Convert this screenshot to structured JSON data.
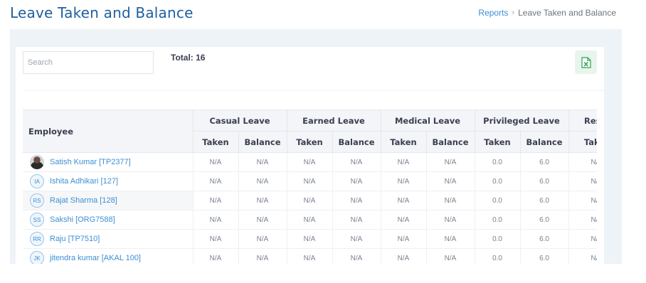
{
  "header": {
    "title": "Leave Taken and Balance",
    "breadcrumb": {
      "link": "Reports",
      "current": "Leave Taken and Balance"
    }
  },
  "toolbar": {
    "search_placeholder": "Search",
    "total": "Total: 16",
    "export_icon": "excel-icon"
  },
  "table": {
    "employee_header": "Employee",
    "leave_types": [
      "Casual Leave",
      "Earned Leave",
      "Medical Leave",
      "Privileged Leave",
      "Rest"
    ],
    "sub_headers": {
      "taken": "Taken",
      "balance": "Balance",
      "partial": "Take"
    },
    "rows": [
      {
        "name": "Satish Kumar [TP2377]",
        "initials": "",
        "photo": true,
        "values": [
          "N/A",
          "N/A",
          "N/A",
          "N/A",
          "N/A",
          "N/A",
          "0.0",
          "6.0",
          "N/"
        ]
      },
      {
        "name": "Ishita Adhikari [127]",
        "initials": "IA",
        "photo": false,
        "values": [
          "N/A",
          "N/A",
          "N/A",
          "N/A",
          "N/A",
          "N/A",
          "0.0",
          "6.0",
          "N/"
        ]
      },
      {
        "name": "Rajat Sharma [128]",
        "initials": "RS",
        "photo": false,
        "values": [
          "N/A",
          "N/A",
          "N/A",
          "N/A",
          "N/A",
          "N/A",
          "0.0",
          "6.0",
          "N/"
        ]
      },
      {
        "name": "Sakshi [ORG7588]",
        "initials": "SS",
        "photo": false,
        "values": [
          "N/A",
          "N/A",
          "N/A",
          "N/A",
          "N/A",
          "N/A",
          "0.0",
          "6.0",
          "N/"
        ]
      },
      {
        "name": "Raju [TP7510]",
        "initials": "RR",
        "photo": false,
        "values": [
          "N/A",
          "N/A",
          "N/A",
          "N/A",
          "N/A",
          "N/A",
          "0.0",
          "6.0",
          "N/"
        ]
      },
      {
        "name": "jitendra kumar [AKAL 100]",
        "initials": "JK",
        "photo": false,
        "values": [
          "N/A",
          "N/A",
          "N/A",
          "N/A",
          "N/A",
          "N/A",
          "0.0",
          "6.0",
          "N/"
        ]
      }
    ]
  },
  "colors": {
    "title": "#1f5f9e",
    "link": "#3d8fd6",
    "panel_bg": "#eef3f7",
    "excel_green": "#2e9e4f"
  }
}
